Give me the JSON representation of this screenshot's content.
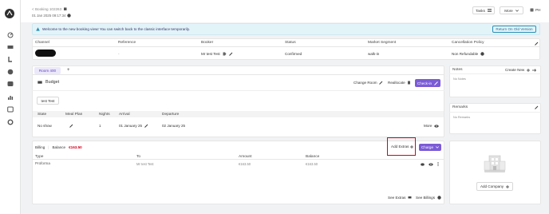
{
  "header": {
    "breadcrumb": "< Booking 102263",
    "subtitle": "01 Jan 2025 09:17:34",
    "tasks": "Tasks",
    "more": "More",
    "user_initials": "PH"
  },
  "banner": {
    "message": "Welcome to the new booking view! You can switch back to the classic interface temporarily.",
    "button": "Return On Old Version"
  },
  "summary": {
    "columns": [
      "Channel",
      "Reference",
      "Booker",
      "Status",
      "Market Segment",
      "Cancellation Policy"
    ],
    "reference": "-",
    "booker": "Mr test Test",
    "status": "Confirmed",
    "segment": "walk-in",
    "policy": "Non Refundable"
  },
  "room": {
    "tab": "Room 400",
    "add_tab": "+",
    "name": "Budget",
    "change_room": "Change Room",
    "reallocate": "Reallocate",
    "check_in": "Check-in",
    "guest_chip": "test Test",
    "columns": [
      "State",
      "Meal Plan",
      "Nights",
      "Arrival",
      "Departure"
    ],
    "state": "No show",
    "nights": "1",
    "arrival": "01 January 25",
    "departure": "02 January 25",
    "more": "More"
  },
  "billing": {
    "label": "Billing",
    "balance_label": "Balance",
    "balance_value": "€163.50",
    "add_extras": "Add Extras",
    "charge": "Charge",
    "columns": [
      "Type",
      "To",
      "Amount",
      "Balance"
    ],
    "row": {
      "type": "Proforma",
      "to": "Mr test Test",
      "amount": "€163.50",
      "balance": "€163.50"
    },
    "see_extras": "See Extras",
    "see_billings": "See Billings"
  },
  "notes": {
    "title": "Notes",
    "create": "Create New",
    "empty": "No Notes"
  },
  "remarks": {
    "title": "Remarks",
    "empty": "No Remarks"
  },
  "company": {
    "add": "Add Company"
  },
  "colors": {
    "accent": "#7b5bd6",
    "highlight": "#d0021b",
    "banner_bg": "#e3f4f9"
  }
}
